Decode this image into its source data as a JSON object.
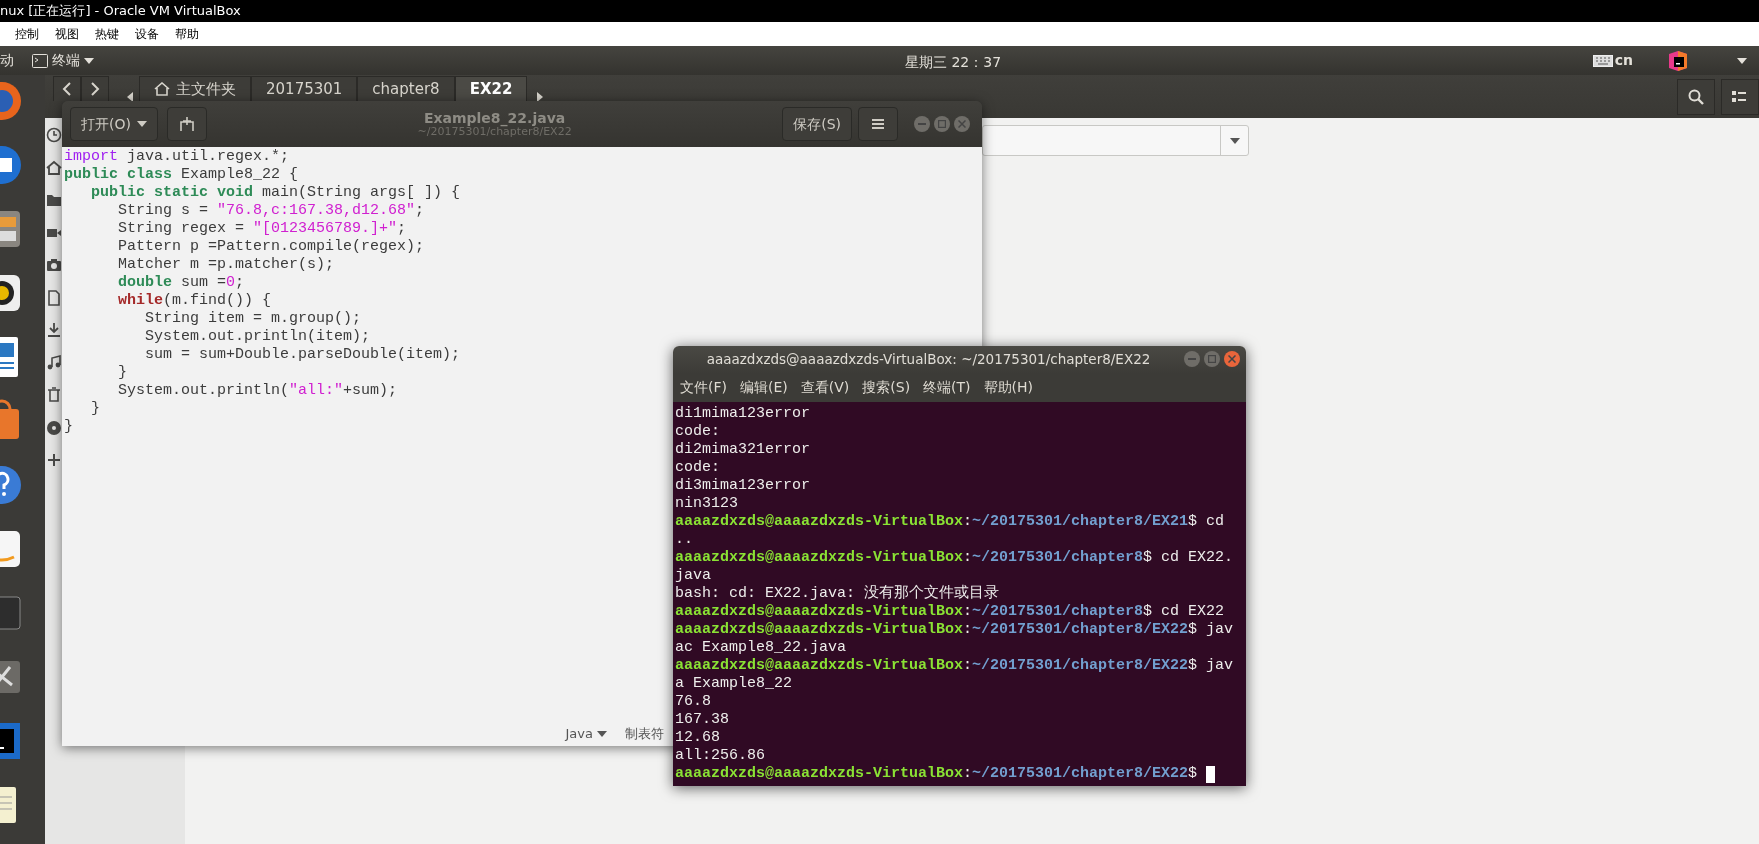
{
  "vm_window": {
    "title": "nux [正在运行] - Oracle VM VirtualBox",
    "menu": [
      "控制",
      "视图",
      "热键",
      "设备",
      "帮助"
    ]
  },
  "top_panel": {
    "activities": "动",
    "app_menu": "终端",
    "clock": "星期三 22：37",
    "input_method": "cn"
  },
  "file_manager": {
    "path": [
      {
        "label": "主文件夹",
        "kind": "home",
        "selected": false
      },
      {
        "label": "20175301",
        "kind": "folder",
        "selected": false
      },
      {
        "label": "chapter8",
        "kind": "folder",
        "selected": false
      },
      {
        "label": "EX22",
        "kind": "folder",
        "selected": true
      }
    ]
  },
  "editor": {
    "title": "Example8_22.java",
    "subtitle": "~/20175301/chapter8/EX22",
    "open_button": "打开(O)",
    "save_button": "保存(S)",
    "lines": [
      {
        "segments": [
          {
            "kind": "keyword",
            "text": "import"
          },
          {
            "kind": "plain",
            "text": " java.util.regex.*;"
          }
        ]
      },
      {
        "segments": [
          {
            "kind": "type",
            "text": "public class"
          },
          {
            "kind": "plain",
            "text": " Example8_22 {"
          }
        ],
        "children": [
          {
            "segments": [
              {
                "kind": "type",
                "text": "public static void"
              },
              {
                "kind": "plain",
                "text": " main(String args[ ]) {"
              }
            ],
            "children": [
              {
                "segments": [
                  {
                    "kind": "plain",
                    "text": "String s = "
                  },
                  {
                    "kind": "string",
                    "text": "\"76.8,c:167.38,d12.68\""
                  },
                  {
                    "kind": "plain",
                    "text": ";"
                  }
                ]
              },
              {
                "segments": [
                  {
                    "kind": "plain",
                    "text": "String regex = "
                  },
                  {
                    "kind": "string",
                    "text": "\"[0123456789.]+\""
                  },
                  {
                    "kind": "plain",
                    "text": ";"
                  }
                ]
              },
              {
                "segments": [
                  {
                    "kind": "plain",
                    "text": "Pattern p =Pattern.compile(regex);"
                  }
                ]
              },
              {
                "segments": [
                  {
                    "kind": "plain",
                    "text": "Matcher m =p.matcher(s);"
                  }
                ]
              },
              {
                "segments": [
                  {
                    "kind": "type",
                    "text": "double"
                  },
                  {
                    "kind": "plain",
                    "text": " sum ="
                  },
                  {
                    "kind": "number",
                    "text": "0"
                  },
                  {
                    "kind": "plain",
                    "text": ";"
                  }
                ]
              },
              {
                "segments": [
                  {
                    "kind": "control",
                    "text": "while"
                  },
                  {
                    "kind": "plain",
                    "text": "(m.find()) {"
                  }
                ],
                "children": [
                  {
                    "segments": [
                      {
                        "kind": "plain",
                        "text": "String item = m.group();"
                      }
                    ]
                  },
                  {
                    "segments": [
                      {
                        "kind": "plain",
                        "text": "System.out.println(item);"
                      }
                    ]
                  },
                  {
                    "segments": [
                      {
                        "kind": "plain",
                        "text": "sum = sum+Double.parseDouble(item);"
                      }
                    ]
                  }
                ]
              },
              {
                "segments": [
                  {
                    "kind": "plain",
                    "text": "}"
                  }
                ]
              },
              {
                "segments": [
                  {
                    "kind": "plain",
                    "text": "System.out.println("
                  },
                  {
                    "kind": "string",
                    "text": "\"all:\""
                  },
                  {
                    "kind": "plain",
                    "text": "+sum);"
                  }
                ]
              }
            ]
          },
          {
            "segments": [
              {
                "kind": "plain",
                "text": "}"
              }
            ]
          }
        ]
      },
      {
        "segments": [
          {
            "kind": "plain",
            "text": "}"
          }
        ]
      }
    ],
    "status": {
      "language": "Java",
      "tab_width": "制表符"
    }
  },
  "terminal": {
    "title": "aaaazdxzds@aaaazdxzds-VirtualBox: ~/20175301/chapter8/EX22",
    "menu": [
      "文件(F)",
      "编辑(E)",
      "查看(V)",
      "搜索(S)",
      "终端(T)",
      "帮助(H)"
    ],
    "lines": [
      {
        "segments": [
          {
            "kind": "plain",
            "text": "di1mima123error"
          }
        ]
      },
      {
        "segments": [
          {
            "kind": "plain",
            "text": "code:"
          }
        ]
      },
      {
        "segments": [
          {
            "kind": "plain",
            "text": "di2mima321error"
          }
        ]
      },
      {
        "segments": [
          {
            "kind": "plain",
            "text": "code:"
          }
        ]
      },
      {
        "segments": [
          {
            "kind": "plain",
            "text": "di3mima123error"
          }
        ]
      },
      {
        "segments": [
          {
            "kind": "plain",
            "text": "nin3123"
          }
        ]
      },
      {
        "segments": [
          {
            "kind": "user",
            "text": "aaaazdxzds@aaaazdxzds-VirtualBox"
          },
          {
            "kind": "plain",
            "text": ":"
          },
          {
            "kind": "path",
            "text": "~/20175301/chapter8/EX21"
          },
          {
            "kind": "plain",
            "text": "$ cd"
          }
        ]
      },
      {
        "segments": [
          {
            "kind": "plain",
            "text": ".."
          }
        ]
      },
      {
        "segments": [
          {
            "kind": "user",
            "text": "aaaazdxzds@aaaazdxzds-VirtualBox"
          },
          {
            "kind": "plain",
            "text": ":"
          },
          {
            "kind": "path",
            "text": "~/20175301/chapter8"
          },
          {
            "kind": "plain",
            "text": "$ cd EX22."
          }
        ]
      },
      {
        "segments": [
          {
            "kind": "plain",
            "text": "java"
          }
        ]
      },
      {
        "segments": [
          {
            "kind": "plain",
            "text": "bash: cd: EX22.java: 没有那个文件或目录"
          }
        ]
      },
      {
        "segments": [
          {
            "kind": "user",
            "text": "aaaazdxzds@aaaazdxzds-VirtualBox"
          },
          {
            "kind": "plain",
            "text": ":"
          },
          {
            "kind": "path",
            "text": "~/20175301/chapter8"
          },
          {
            "kind": "plain",
            "text": "$ cd EX22"
          }
        ]
      },
      {
        "segments": [
          {
            "kind": "user",
            "text": "aaaazdxzds@aaaazdxzds-VirtualBox"
          },
          {
            "kind": "plain",
            "text": ":"
          },
          {
            "kind": "path",
            "text": "~/20175301/chapter8/EX22"
          },
          {
            "kind": "plain",
            "text": "$ jav"
          }
        ]
      },
      {
        "segments": [
          {
            "kind": "plain",
            "text": "ac Example8_22.java"
          }
        ]
      },
      {
        "segments": [
          {
            "kind": "user",
            "text": "aaaazdxzds@aaaazdxzds-VirtualBox"
          },
          {
            "kind": "plain",
            "text": ":"
          },
          {
            "kind": "path",
            "text": "~/20175301/chapter8/EX22"
          },
          {
            "kind": "plain",
            "text": "$ jav"
          }
        ]
      },
      {
        "segments": [
          {
            "kind": "plain",
            "text": "a Example8_22"
          }
        ]
      },
      {
        "segments": [
          {
            "kind": "plain",
            "text": "76.8"
          }
        ]
      },
      {
        "segments": [
          {
            "kind": "plain",
            "text": "167.38"
          }
        ]
      },
      {
        "segments": [
          {
            "kind": "plain",
            "text": "12.68"
          }
        ]
      },
      {
        "segments": [
          {
            "kind": "plain",
            "text": "all:256.86"
          }
        ]
      },
      {
        "segments": [
          {
            "kind": "user",
            "text": "aaaazdxzds@aaaazdxzds-VirtualBox"
          },
          {
            "kind": "plain",
            "text": ":"
          },
          {
            "kind": "path",
            "text": "~/20175301/chapter8/EX22"
          },
          {
            "kind": "plain",
            "text": "$"
          }
        ],
        "cursor": true
      }
    ]
  }
}
